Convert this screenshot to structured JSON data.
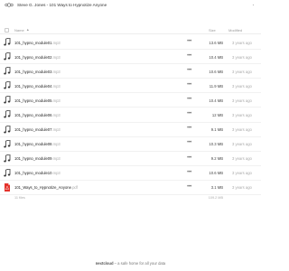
{
  "header": {
    "breadcrumb": "Steve G. Jones - 101 Ways to Hypnotize Anyone"
  },
  "columns": {
    "name": "Name",
    "sort_arrow": "▲",
    "size": "Size",
    "modified": "Modified"
  },
  "files": [
    {
      "name": "101_hypno_module01",
      "ext": ".mp3",
      "size": "13.6 MB",
      "modified": "3 years ago",
      "icon": "audio-file-icon"
    },
    {
      "name": "101_hypno_module02",
      "ext": ".mp3",
      "size": "10.4 MB",
      "modified": "3 years ago",
      "icon": "audio-file-icon"
    },
    {
      "name": "101_hypno_module03",
      "ext": ".mp3",
      "size": "10.6 MB",
      "modified": "3 years ago",
      "icon": "audio-file-icon"
    },
    {
      "name": "101_hypno_module04",
      "ext": ".mp3",
      "size": "11.9 MB",
      "modified": "3 years ago",
      "icon": "audio-file-icon"
    },
    {
      "name": "101_hypno_module05",
      "ext": ".mp3",
      "size": "10.4 MB",
      "modified": "3 years ago",
      "icon": "audio-file-icon"
    },
    {
      "name": "101_hypno_module06",
      "ext": ".mp3",
      "size": "12 MB",
      "modified": "3 years ago",
      "icon": "audio-file-icon"
    },
    {
      "name": "101_hypno_module07",
      "ext": ".mp3",
      "size": "9.1 MB",
      "modified": "3 years ago",
      "icon": "audio-file-icon"
    },
    {
      "name": "101_hypno_module08",
      "ext": ".mp3",
      "size": "10.3 MB",
      "modified": "3 years ago",
      "icon": "audio-file-icon"
    },
    {
      "name": "101_hypno_module09",
      "ext": ".mp3",
      "size": "9.2 MB",
      "modified": "3 years ago",
      "icon": "audio-file-icon"
    },
    {
      "name": "101_hypno_module10",
      "ext": ".mp3",
      "size": "10.6 MB",
      "modified": "3 years ago",
      "icon": "audio-file-icon"
    },
    {
      "name": "101_Ways_to_Hypnotize_Anyone",
      "ext": ".pdf",
      "size": "3.1 MB",
      "modified": "3 years ago",
      "icon": "pdf-file-icon"
    }
  ],
  "summary": {
    "count": "11 files",
    "total": "109.2 MB"
  },
  "footer": {
    "brand": "nextcloud",
    "tagline": " – a safe home for all your data"
  },
  "colors": {
    "pdf_red": "#e4322b",
    "icon_dark": "#333333",
    "brand_blue": "#0082c9"
  }
}
